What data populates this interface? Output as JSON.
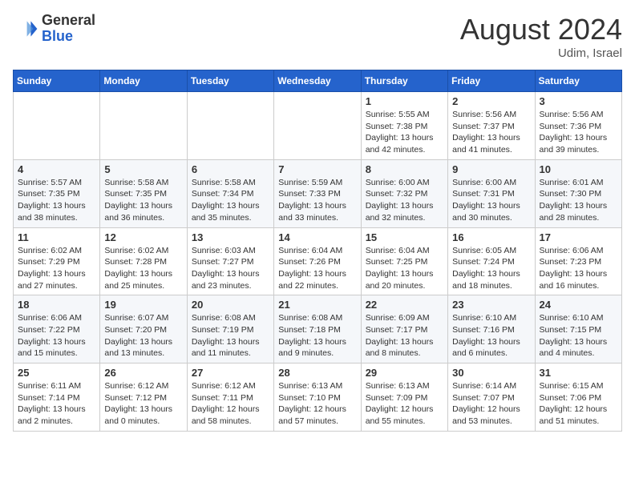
{
  "header": {
    "logo_general": "General",
    "logo_blue": "Blue",
    "month_year": "August 2024",
    "location": "Udim, Israel"
  },
  "weekdays": [
    "Sunday",
    "Monday",
    "Tuesday",
    "Wednesday",
    "Thursday",
    "Friday",
    "Saturday"
  ],
  "weeks": [
    [
      {
        "day": "",
        "info": ""
      },
      {
        "day": "",
        "info": ""
      },
      {
        "day": "",
        "info": ""
      },
      {
        "day": "",
        "info": ""
      },
      {
        "day": "1",
        "info": "Sunrise: 5:55 AM\nSunset: 7:38 PM\nDaylight: 13 hours\nand 42 minutes."
      },
      {
        "day": "2",
        "info": "Sunrise: 5:56 AM\nSunset: 7:37 PM\nDaylight: 13 hours\nand 41 minutes."
      },
      {
        "day": "3",
        "info": "Sunrise: 5:56 AM\nSunset: 7:36 PM\nDaylight: 13 hours\nand 39 minutes."
      }
    ],
    [
      {
        "day": "4",
        "info": "Sunrise: 5:57 AM\nSunset: 7:35 PM\nDaylight: 13 hours\nand 38 minutes."
      },
      {
        "day": "5",
        "info": "Sunrise: 5:58 AM\nSunset: 7:35 PM\nDaylight: 13 hours\nand 36 minutes."
      },
      {
        "day": "6",
        "info": "Sunrise: 5:58 AM\nSunset: 7:34 PM\nDaylight: 13 hours\nand 35 minutes."
      },
      {
        "day": "7",
        "info": "Sunrise: 5:59 AM\nSunset: 7:33 PM\nDaylight: 13 hours\nand 33 minutes."
      },
      {
        "day": "8",
        "info": "Sunrise: 6:00 AM\nSunset: 7:32 PM\nDaylight: 13 hours\nand 32 minutes."
      },
      {
        "day": "9",
        "info": "Sunrise: 6:00 AM\nSunset: 7:31 PM\nDaylight: 13 hours\nand 30 minutes."
      },
      {
        "day": "10",
        "info": "Sunrise: 6:01 AM\nSunset: 7:30 PM\nDaylight: 13 hours\nand 28 minutes."
      }
    ],
    [
      {
        "day": "11",
        "info": "Sunrise: 6:02 AM\nSunset: 7:29 PM\nDaylight: 13 hours\nand 27 minutes."
      },
      {
        "day": "12",
        "info": "Sunrise: 6:02 AM\nSunset: 7:28 PM\nDaylight: 13 hours\nand 25 minutes."
      },
      {
        "day": "13",
        "info": "Sunrise: 6:03 AM\nSunset: 7:27 PM\nDaylight: 13 hours\nand 23 minutes."
      },
      {
        "day": "14",
        "info": "Sunrise: 6:04 AM\nSunset: 7:26 PM\nDaylight: 13 hours\nand 22 minutes."
      },
      {
        "day": "15",
        "info": "Sunrise: 6:04 AM\nSunset: 7:25 PM\nDaylight: 13 hours\nand 20 minutes."
      },
      {
        "day": "16",
        "info": "Sunrise: 6:05 AM\nSunset: 7:24 PM\nDaylight: 13 hours\nand 18 minutes."
      },
      {
        "day": "17",
        "info": "Sunrise: 6:06 AM\nSunset: 7:23 PM\nDaylight: 13 hours\nand 16 minutes."
      }
    ],
    [
      {
        "day": "18",
        "info": "Sunrise: 6:06 AM\nSunset: 7:22 PM\nDaylight: 13 hours\nand 15 minutes."
      },
      {
        "day": "19",
        "info": "Sunrise: 6:07 AM\nSunset: 7:20 PM\nDaylight: 13 hours\nand 13 minutes."
      },
      {
        "day": "20",
        "info": "Sunrise: 6:08 AM\nSunset: 7:19 PM\nDaylight: 13 hours\nand 11 minutes."
      },
      {
        "day": "21",
        "info": "Sunrise: 6:08 AM\nSunset: 7:18 PM\nDaylight: 13 hours\nand 9 minutes."
      },
      {
        "day": "22",
        "info": "Sunrise: 6:09 AM\nSunset: 7:17 PM\nDaylight: 13 hours\nand 8 minutes."
      },
      {
        "day": "23",
        "info": "Sunrise: 6:10 AM\nSunset: 7:16 PM\nDaylight: 13 hours\nand 6 minutes."
      },
      {
        "day": "24",
        "info": "Sunrise: 6:10 AM\nSunset: 7:15 PM\nDaylight: 13 hours\nand 4 minutes."
      }
    ],
    [
      {
        "day": "25",
        "info": "Sunrise: 6:11 AM\nSunset: 7:14 PM\nDaylight: 13 hours\nand 2 minutes."
      },
      {
        "day": "26",
        "info": "Sunrise: 6:12 AM\nSunset: 7:12 PM\nDaylight: 13 hours\nand 0 minutes."
      },
      {
        "day": "27",
        "info": "Sunrise: 6:12 AM\nSunset: 7:11 PM\nDaylight: 12 hours\nand 58 minutes."
      },
      {
        "day": "28",
        "info": "Sunrise: 6:13 AM\nSunset: 7:10 PM\nDaylight: 12 hours\nand 57 minutes."
      },
      {
        "day": "29",
        "info": "Sunrise: 6:13 AM\nSunset: 7:09 PM\nDaylight: 12 hours\nand 55 minutes."
      },
      {
        "day": "30",
        "info": "Sunrise: 6:14 AM\nSunset: 7:07 PM\nDaylight: 12 hours\nand 53 minutes."
      },
      {
        "day": "31",
        "info": "Sunrise: 6:15 AM\nSunset: 7:06 PM\nDaylight: 12 hours\nand 51 minutes."
      }
    ]
  ]
}
